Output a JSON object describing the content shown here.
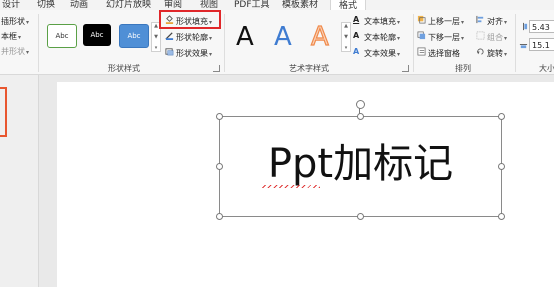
{
  "tabs": [
    "设计",
    "切换",
    "动画",
    "幻灯片放映",
    "审阅",
    "视图",
    "PDF工具",
    "模板素材",
    "格式"
  ],
  "active_tab": "格式",
  "ribbon": {
    "left_partial": [
      "插形状",
      "本框",
      "并形状"
    ],
    "shape_styles": {
      "label": "形状样式",
      "buttons": [
        "Abc",
        "Abc",
        "Abc"
      ],
      "fill": "形状填充",
      "outline": "形状轮廓",
      "effects": "形状效果"
    },
    "wordart": {
      "label": "艺术字样式",
      "letters": [
        "A",
        "A",
        "A"
      ],
      "text_fill": "文本填充",
      "text_outline": "文本轮廓",
      "text_effects": "文本效果"
    },
    "arrange": {
      "label": "排列",
      "bring_forward": "上移一层",
      "send_backward": "下移一层",
      "selection_pane": "选择窗格",
      "align": "对齐",
      "group": "组合",
      "rotate": "旋转"
    },
    "size": {
      "label": "大小",
      "height": "5.43",
      "width": "15.1"
    }
  },
  "slide": {
    "textbox_text": "Ppt加标记"
  },
  "colors": {
    "accent": "#e8562f",
    "highlight": "#e0272a",
    "wordart_blue": "#3f7cd1",
    "wordart_orange": "#f08a4b"
  }
}
